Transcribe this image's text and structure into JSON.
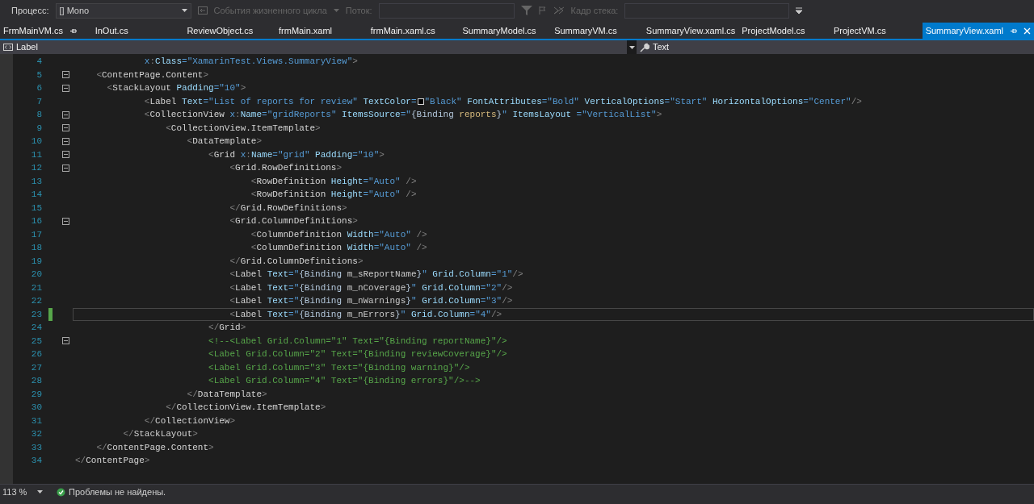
{
  "toolbar": {
    "process_label": "Процесс:",
    "process_value": "[] Mono",
    "lifecycle_label": "События жизненного цикла",
    "lifecycle_disabled": true,
    "thread_label": "Поток:",
    "thread_disabled": true,
    "stack_label": "Кадр стека:",
    "stack_disabled": true
  },
  "tabs": [
    {
      "label": "FrmMainVM.cs",
      "selected": false,
      "pinned": true
    },
    {
      "label": "InOut.cs",
      "selected": false,
      "pinned": false
    },
    {
      "label": "ReviewObject.cs",
      "selected": false,
      "pinned": false
    },
    {
      "label": "frmMain.xaml",
      "selected": false,
      "pinned": false
    },
    {
      "label": "frmMain.xaml.cs",
      "selected": false,
      "pinned": false
    },
    {
      "label": "SummaryModel.cs",
      "selected": false,
      "pinned": false
    },
    {
      "label": "SummaryVM.cs",
      "selected": false,
      "pinned": false
    },
    {
      "label": "SummaryView.xaml.cs",
      "selected": false,
      "pinned": false
    },
    {
      "label": "ProjectModel.cs",
      "selected": false,
      "pinned": false
    },
    {
      "label": "ProjectVM.cs",
      "selected": false,
      "pinned": false
    },
    {
      "label": "SummaryView.xaml",
      "selected": true,
      "pinned": true
    }
  ],
  "nav_bar": {
    "element": "Label",
    "member": "Text"
  },
  "code_lines": [
    {
      "number": "4",
      "foldable": false,
      "changed": false,
      "current": false,
      "tokens": [
        {
          "kind": "prefix",
          "text": "             x"
        },
        {
          "kind": "bracket",
          "text": ":"
        },
        {
          "kind": "attr",
          "text": "Class"
        },
        {
          "kind": "string",
          "text": "=\"XamarinTest.Views.SummaryView\""
        },
        {
          "kind": "bracket",
          "text": ">"
        }
      ]
    },
    {
      "number": "5",
      "foldable": true,
      "changed": false,
      "current": false,
      "tokens": [
        {
          "kind": "bracket",
          "text": "    <"
        },
        {
          "kind": "tag",
          "text": "ContentPage.Content"
        },
        {
          "kind": "bracket",
          "text": ">"
        }
      ]
    },
    {
      "number": "6",
      "foldable": true,
      "changed": false,
      "current": false,
      "tokens": [
        {
          "kind": "bracket",
          "text": "      <"
        },
        {
          "kind": "tag",
          "text": "StackLayout "
        },
        {
          "kind": "attr",
          "text": "Padding"
        },
        {
          "kind": "string",
          "text": "=\"10\""
        },
        {
          "kind": "bracket",
          "text": ">"
        }
      ]
    },
    {
      "number": "7",
      "foldable": false,
      "changed": false,
      "current": false,
      "tokens": [
        {
          "kind": "bracket",
          "text": "             <"
        },
        {
          "kind": "tag",
          "text": "Label "
        },
        {
          "kind": "attr",
          "text": "Text"
        },
        {
          "kind": "string",
          "text": "=\"List of reports for review\" "
        },
        {
          "kind": "attr",
          "text": "TextColor"
        },
        {
          "kind": "string",
          "text": "="
        },
        {
          "kind": "swatch",
          "color": "#000000"
        },
        {
          "kind": "string",
          "text": "\"Black\" "
        },
        {
          "kind": "attr",
          "text": "FontAttributes"
        },
        {
          "kind": "string",
          "text": "=\"Bold\" "
        },
        {
          "kind": "attr",
          "text": "VerticalOptions"
        },
        {
          "kind": "string",
          "text": "=\"Start\" "
        },
        {
          "kind": "attr",
          "text": "HorizontalOptions"
        },
        {
          "kind": "string",
          "text": "=\"Center\""
        },
        {
          "kind": "bracket",
          "text": "/>"
        }
      ]
    },
    {
      "number": "8",
      "foldable": true,
      "changed": false,
      "current": false,
      "tokens": [
        {
          "kind": "bracket",
          "text": "             <"
        },
        {
          "kind": "tag",
          "text": "CollectionView "
        },
        {
          "kind": "prefix",
          "text": "x"
        },
        {
          "kind": "bracket",
          "text": ":"
        },
        {
          "kind": "attr",
          "text": "Name"
        },
        {
          "kind": "string",
          "text": "=\"gridReports\" "
        },
        {
          "kind": "attr",
          "text": "ItemsSource"
        },
        {
          "kind": "string",
          "text": "=\""
        },
        {
          "kind": "markup",
          "text": "{Binding "
        },
        {
          "kind": "path",
          "text": "reports"
        },
        {
          "kind": "markup",
          "text": "}"
        },
        {
          "kind": "string",
          "text": "\" "
        },
        {
          "kind": "attr",
          "text": "ItemsLayout "
        },
        {
          "kind": "string",
          "text": "=\"VerticalList\""
        },
        {
          "kind": "bracket",
          "text": ">"
        }
      ]
    },
    {
      "number": "9",
      "foldable": true,
      "changed": false,
      "current": false,
      "tokens": [
        {
          "kind": "bracket",
          "text": "                 <"
        },
        {
          "kind": "tag",
          "text": "CollectionView.ItemTemplate"
        },
        {
          "kind": "bracket",
          "text": ">"
        }
      ]
    },
    {
      "number": "10",
      "foldable": true,
      "changed": false,
      "current": false,
      "tokens": [
        {
          "kind": "bracket",
          "text": "                     <"
        },
        {
          "kind": "tag",
          "text": "DataTemplate"
        },
        {
          "kind": "bracket",
          "text": ">"
        }
      ]
    },
    {
      "number": "11",
      "foldable": true,
      "changed": false,
      "current": false,
      "tokens": [
        {
          "kind": "bracket",
          "text": "                         <"
        },
        {
          "kind": "tag",
          "text": "Grid "
        },
        {
          "kind": "prefix",
          "text": "x"
        },
        {
          "kind": "bracket",
          "text": ":"
        },
        {
          "kind": "attr",
          "text": "Name"
        },
        {
          "kind": "string",
          "text": "=\"grid\" "
        },
        {
          "kind": "attr",
          "text": "Padding"
        },
        {
          "kind": "string",
          "text": "=\"10\""
        },
        {
          "kind": "bracket",
          "text": ">"
        }
      ]
    },
    {
      "number": "12",
      "foldable": true,
      "changed": false,
      "current": false,
      "tokens": [
        {
          "kind": "bracket",
          "text": "                             <"
        },
        {
          "kind": "tag",
          "text": "Grid.RowDefinitions"
        },
        {
          "kind": "bracket",
          "text": ">"
        }
      ]
    },
    {
      "number": "13",
      "foldable": false,
      "changed": false,
      "current": false,
      "tokens": [
        {
          "kind": "bracket",
          "text": "                                 <"
        },
        {
          "kind": "tag",
          "text": "RowDefinition "
        },
        {
          "kind": "attr",
          "text": "Height"
        },
        {
          "kind": "string",
          "text": "=\"Auto\" "
        },
        {
          "kind": "bracket",
          "text": "/>"
        }
      ]
    },
    {
      "number": "14",
      "foldable": false,
      "changed": false,
      "current": false,
      "tokens": [
        {
          "kind": "bracket",
          "text": "                                 <"
        },
        {
          "kind": "tag",
          "text": "RowDefinition "
        },
        {
          "kind": "attr",
          "text": "Height"
        },
        {
          "kind": "string",
          "text": "=\"Auto\" "
        },
        {
          "kind": "bracket",
          "text": "/>"
        }
      ]
    },
    {
      "number": "15",
      "foldable": false,
      "changed": false,
      "current": false,
      "tokens": [
        {
          "kind": "bracket",
          "text": "                             </"
        },
        {
          "kind": "tag",
          "text": "Grid.RowDefinitions"
        },
        {
          "kind": "bracket",
          "text": ">"
        }
      ]
    },
    {
      "number": "16",
      "foldable": true,
      "changed": false,
      "current": false,
      "tokens": [
        {
          "kind": "bracket",
          "text": "                             <"
        },
        {
          "kind": "tag",
          "text": "Grid.ColumnDefinitions"
        },
        {
          "kind": "bracket",
          "text": ">"
        }
      ]
    },
    {
      "number": "17",
      "foldable": false,
      "changed": false,
      "current": false,
      "tokens": [
        {
          "kind": "bracket",
          "text": "                                 <"
        },
        {
          "kind": "tag",
          "text": "ColumnDefinition "
        },
        {
          "kind": "attr",
          "text": "Width"
        },
        {
          "kind": "string",
          "text": "=\"Auto\" "
        },
        {
          "kind": "bracket",
          "text": "/>"
        }
      ]
    },
    {
      "number": "18",
      "foldable": false,
      "changed": false,
      "current": false,
      "tokens": [
        {
          "kind": "bracket",
          "text": "                                 <"
        },
        {
          "kind": "tag",
          "text": "ColumnDefinition "
        },
        {
          "kind": "attr",
          "text": "Width"
        },
        {
          "kind": "string",
          "text": "=\"Auto\" "
        },
        {
          "kind": "bracket",
          "text": "/>"
        }
      ]
    },
    {
      "number": "19",
      "foldable": false,
      "changed": false,
      "current": false,
      "tokens": [
        {
          "kind": "bracket",
          "text": "                             </"
        },
        {
          "kind": "tag",
          "text": "Grid.ColumnDefinitions"
        },
        {
          "kind": "bracket",
          "text": ">"
        }
      ]
    },
    {
      "number": "20",
      "foldable": false,
      "changed": false,
      "current": false,
      "tokens": [
        {
          "kind": "bracket",
          "text": "                             <"
        },
        {
          "kind": "tag",
          "text": "Label "
        },
        {
          "kind": "attr",
          "text": "Text"
        },
        {
          "kind": "string",
          "text": "=\""
        },
        {
          "kind": "markup",
          "text": "{Binding "
        },
        {
          "kind": "member",
          "text": "m_sReportName"
        },
        {
          "kind": "markup",
          "text": "}"
        },
        {
          "kind": "string",
          "text": "\" "
        },
        {
          "kind": "attr",
          "text": "Grid.Column"
        },
        {
          "kind": "string",
          "text": "=\"1\""
        },
        {
          "kind": "bracket",
          "text": "/>"
        }
      ]
    },
    {
      "number": "21",
      "foldable": false,
      "changed": false,
      "current": false,
      "tokens": [
        {
          "kind": "bracket",
          "text": "                             <"
        },
        {
          "kind": "tag",
          "text": "Label "
        },
        {
          "kind": "attr",
          "text": "Text"
        },
        {
          "kind": "string",
          "text": "=\""
        },
        {
          "kind": "markup",
          "text": "{Binding "
        },
        {
          "kind": "member",
          "text": "m_nCoverage"
        },
        {
          "kind": "markup",
          "text": "}"
        },
        {
          "kind": "string",
          "text": "\" "
        },
        {
          "kind": "attr",
          "text": "Grid.Column"
        },
        {
          "kind": "string",
          "text": "=\"2\""
        },
        {
          "kind": "bracket",
          "text": "/>"
        }
      ]
    },
    {
      "number": "22",
      "foldable": false,
      "changed": false,
      "current": false,
      "tokens": [
        {
          "kind": "bracket",
          "text": "                             <"
        },
        {
          "kind": "tag",
          "text": "Label "
        },
        {
          "kind": "attr",
          "text": "Text"
        },
        {
          "kind": "string",
          "text": "=\""
        },
        {
          "kind": "markup",
          "text": "{Binding "
        },
        {
          "kind": "member",
          "text": "m_nWarnings"
        },
        {
          "kind": "markup",
          "text": "}"
        },
        {
          "kind": "string",
          "text": "\" "
        },
        {
          "kind": "attr",
          "text": "Grid.Column"
        },
        {
          "kind": "string",
          "text": "=\"3\""
        },
        {
          "kind": "bracket",
          "text": "/>"
        }
      ]
    },
    {
      "number": "23",
      "foldable": false,
      "changed": true,
      "current": true,
      "tokens": [
        {
          "kind": "bracket",
          "text": "                             <"
        },
        {
          "kind": "tag",
          "text": "Label "
        },
        {
          "kind": "attr",
          "text": "Text"
        },
        {
          "kind": "string",
          "text": "=\""
        },
        {
          "kind": "markup",
          "text": "{Binding "
        },
        {
          "kind": "member",
          "text": "m_nErrors"
        },
        {
          "kind": "markup",
          "text": "}"
        },
        {
          "kind": "string",
          "text": "\" "
        },
        {
          "kind": "attr",
          "text": "Grid.Column"
        },
        {
          "kind": "string",
          "text": "=\"4\""
        },
        {
          "kind": "bracket",
          "text": "/>"
        }
      ]
    },
    {
      "number": "24",
      "foldable": false,
      "changed": false,
      "current": false,
      "tokens": [
        {
          "kind": "bracket",
          "text": "                         </"
        },
        {
          "kind": "tag",
          "text": "Grid"
        },
        {
          "kind": "bracket",
          "text": ">"
        }
      ]
    },
    {
      "number": "25",
      "foldable": true,
      "changed": false,
      "current": false,
      "tokens": [
        {
          "kind": "comment",
          "text": "                         <!--<Label Grid.Column=\"1\" Text=\"{Binding reportName}\"/>"
        }
      ]
    },
    {
      "number": "26",
      "foldable": false,
      "changed": false,
      "current": false,
      "tokens": [
        {
          "kind": "comment",
          "text": "                         <Label Grid.Column=\"2\" Text=\"{Binding reviewCoverage}\"/>"
        }
      ]
    },
    {
      "number": "27",
      "foldable": false,
      "changed": false,
      "current": false,
      "tokens": [
        {
          "kind": "comment",
          "text": "                         <Label Grid.Column=\"3\" Text=\"{Binding warning}\"/>"
        }
      ]
    },
    {
      "number": "28",
      "foldable": false,
      "changed": false,
      "current": false,
      "tokens": [
        {
          "kind": "comment",
          "text": "                         <Label Grid.Column=\"4\" Text=\"{Binding errors}\"/>-->"
        }
      ]
    },
    {
      "number": "29",
      "foldable": false,
      "changed": false,
      "current": false,
      "tokens": [
        {
          "kind": "bracket",
          "text": "                     </"
        },
        {
          "kind": "tag",
          "text": "DataTemplate"
        },
        {
          "kind": "bracket",
          "text": ">"
        }
      ]
    },
    {
      "number": "30",
      "foldable": false,
      "changed": false,
      "current": false,
      "tokens": [
        {
          "kind": "bracket",
          "text": "                 </"
        },
        {
          "kind": "tag",
          "text": "CollectionView.ItemTemplate"
        },
        {
          "kind": "bracket",
          "text": ">"
        }
      ]
    },
    {
      "number": "31",
      "foldable": false,
      "changed": false,
      "current": false,
      "tokens": [
        {
          "kind": "bracket",
          "text": "             </"
        },
        {
          "kind": "tag",
          "text": "CollectionView"
        },
        {
          "kind": "bracket",
          "text": ">"
        }
      ]
    },
    {
      "number": "32",
      "foldable": false,
      "changed": false,
      "current": false,
      "tokens": [
        {
          "kind": "bracket",
          "text": "         </"
        },
        {
          "kind": "tag",
          "text": "StackLayout"
        },
        {
          "kind": "bracket",
          "text": ">"
        }
      ]
    },
    {
      "number": "33",
      "foldable": false,
      "changed": false,
      "current": false,
      "tokens": [
        {
          "kind": "bracket",
          "text": "    </"
        },
        {
          "kind": "tag",
          "text": "ContentPage.Content"
        },
        {
          "kind": "bracket",
          "text": ">"
        }
      ]
    },
    {
      "number": "34",
      "foldable": false,
      "changed": false,
      "current": false,
      "tokens": [
        {
          "kind": "bracket",
          "text": "</"
        },
        {
          "kind": "tag",
          "text": "ContentPage"
        },
        {
          "kind": "bracket",
          "text": ">"
        }
      ]
    }
  ],
  "status_bar": {
    "zoom": "113 %",
    "message": "Проблемы не найдены."
  }
}
